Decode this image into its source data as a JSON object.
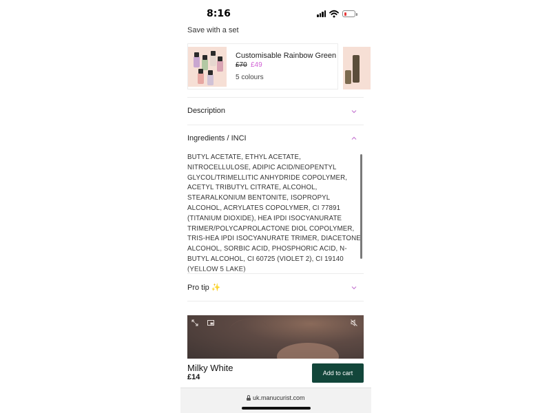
{
  "status_bar": {
    "time": "8:16"
  },
  "set_section": {
    "title": "Save with a set",
    "card": {
      "name": "Customisable Rainbow Green",
      "price_old": "£70",
      "price_new": "£49",
      "colours": "5 colours"
    }
  },
  "accordion": {
    "description": {
      "label": "Description"
    },
    "ingredients": {
      "label": "Ingredients / INCI",
      "text": "BUTYL ACETATE, ETHYL ACETATE, NITROCELLULOSE, ADIPIC ACID/NEOPENTYL GLYCOL/TRIMELLITIC ANHYDRIDE COPOLYMER, ACETYL TRIBUTYL CITRATE, ALCOHOL, STEARALKONIUM BENTONITE, ISOPROPYL ALCOHOL, ACRYLATES COPOLYMER, CI 77891 (TITANIUM DIOXIDE), HEA IPDI ISOCYANURATE TRIMER/POLYCAPROLACTONE DIOL COPOLYMER, TRIS-HEA IPDI ISOCYANURATE TRIMER, DIACETONE ALCOHOL, SORBIC ACID, PHOSPHORIC ACID, N-BUTYL ALCOHOL, CI 60725 (VIOLET 2), CI 19140 (YELLOW 5 LAKE)"
    },
    "pro_tip": {
      "label": "Pro tip ✨"
    }
  },
  "product": {
    "name": "Milky White",
    "price": "£14",
    "add_to_cart": "Add to cart"
  },
  "browser": {
    "url": "uk.manucurist.com"
  },
  "colors": {
    "accent_pink": "#d05fd4",
    "cart_button": "#12463a",
    "chevron": "#c77ad3"
  },
  "icons": {
    "expand": "expand-icon",
    "pip": "picture-in-picture-icon",
    "mute": "speaker-muted-icon",
    "chevron_down": "chevron-down-icon",
    "chevron_up": "chevron-up-icon",
    "lock": "lock-icon"
  }
}
